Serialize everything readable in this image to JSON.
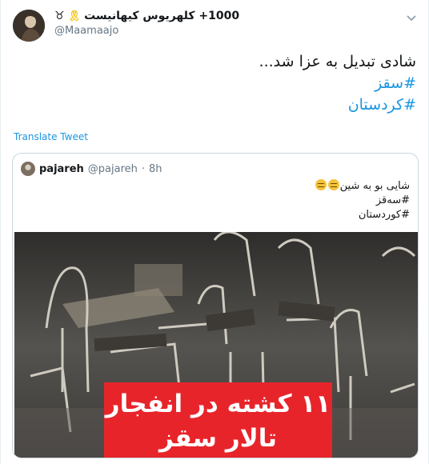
{
  "author": {
    "display_name": "کلهریوس کیهانیست ‎+1000",
    "handle": "@Maamaajo",
    "badges": [
      "taurus-symbol-icon",
      "yellow-ribbon-icon"
    ]
  },
  "tweet": {
    "lines": [
      "شادی تبدیل به عزا شد...",
      "#سقز",
      "#کردستان"
    ]
  },
  "translate_label": "Translate Tweet",
  "quoted": {
    "name": "pajareh",
    "handle": "@pajareh",
    "separator": "·",
    "time": "8h",
    "text_line1": "شایی بو به شین",
    "text_line2": "#سەقز",
    "text_line3": "#کوردستان",
    "emojis": [
      "expressionless-face-icon",
      "expressionless-face-icon"
    ],
    "media": {
      "alt": "overturned chairs and tables after explosion",
      "banner_line1": "۱۱ کشته در انفجار",
      "banner_line2": "تالار سقز"
    }
  },
  "colors": {
    "hashtag": "#1b95e0",
    "banner": "#e8242b",
    "border": "#ccd6dd",
    "muted": "#657786"
  }
}
